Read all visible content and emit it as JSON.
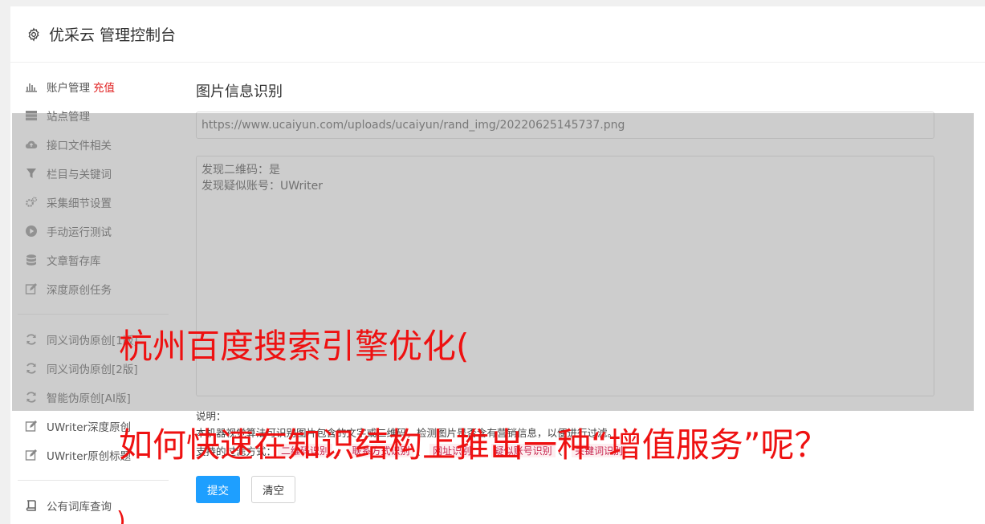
{
  "header": {
    "title": "优采云 管理控制台"
  },
  "sidebar": {
    "items": [
      {
        "label": "账户管理",
        "badge": "充值",
        "icon": "bar-chart-icon"
      },
      {
        "label": "站点管理",
        "icon": "server-icon"
      },
      {
        "label": "接口文件相关",
        "icon": "cloud-upload-icon"
      },
      {
        "label": "栏目与关键词",
        "icon": "filter-icon"
      },
      {
        "label": "采集细节设置",
        "icon": "cogs-icon"
      },
      {
        "label": "手动运行测试",
        "icon": "play-circle-icon"
      },
      {
        "label": "文章暂存库",
        "icon": "database-icon"
      },
      {
        "label": "深度原创任务",
        "icon": "edit-icon"
      }
    ],
    "items2": [
      {
        "label": "同义词伪原创[1版]",
        "icon": "refresh-icon"
      },
      {
        "label": "同义词伪原创[2版]",
        "icon": "refresh-icon"
      },
      {
        "label": "智能伪原创[AI版]",
        "icon": "refresh-icon"
      },
      {
        "label": "UWriter深度原创",
        "icon": "edit-icon"
      },
      {
        "label": "UWriter原创标题",
        "icon": "edit-icon"
      }
    ],
    "items3": [
      {
        "label": "公有词库查询",
        "icon": "book-icon"
      }
    ]
  },
  "main": {
    "title": "图片信息识别",
    "url_value": "https://www.ucaiyun.com/uploads/ucaiyun/rand_img/20220625145737.png",
    "result_lines": [
      "发现二维码：是",
      "发现疑似账号：UWriter"
    ],
    "notes_label": "说明：",
    "notes_text": "本机器视觉算法可识别图片包含的文字或二维码，检测图片是否含有营销信息，以便进行过滤。",
    "filters_label": "支持的过滤方式：",
    "filters": [
      "二维码识别",
      "联系方式识别",
      "网址识别",
      "疑似账号识别",
      "关键词识别"
    ],
    "filter_sep": "、",
    "submit_label": "提交",
    "clear_label": "清空"
  },
  "watermark": {
    "line1": "杭州百度搜索引擎优化(",
    "line2": "如何快速在知识结构上推出一种“增值服务”呢？",
    "line3": ")"
  },
  "colors": {
    "accent": "#1e9fff",
    "recharge": "#e02020",
    "watermark": "#ee1111"
  }
}
